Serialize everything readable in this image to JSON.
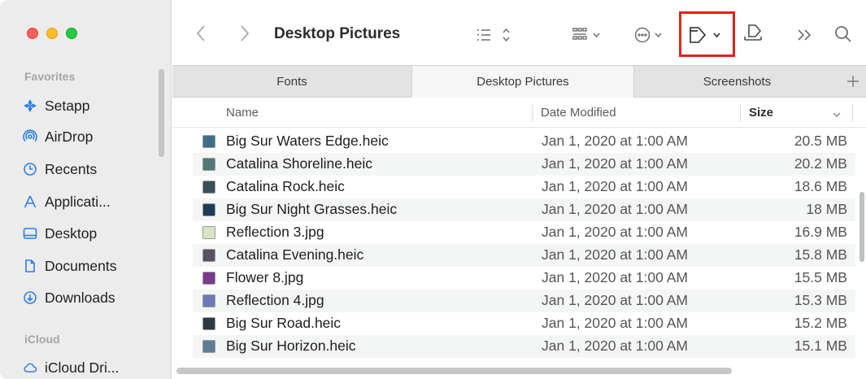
{
  "sidebar": {
    "favorites_label": "Favorites",
    "items": [
      {
        "label": "Setapp",
        "icon": "setapp-icon"
      },
      {
        "label": "AirDrop",
        "icon": "airdrop-icon"
      },
      {
        "label": "Recents",
        "icon": "clock-icon"
      },
      {
        "label": "Applicati...",
        "icon": "applications-icon"
      },
      {
        "label": "Desktop",
        "icon": "desktop-icon"
      },
      {
        "label": "Documents",
        "icon": "document-icon"
      },
      {
        "label": "Downloads",
        "icon": "download-icon"
      }
    ],
    "icloud_label": "iCloud",
    "icloud_items": [
      {
        "label": "iCloud Dri...",
        "icon": "cloud-icon"
      }
    ]
  },
  "toolbar": {
    "title": "Desktop Pictures"
  },
  "tabs": [
    {
      "label": "Fonts"
    },
    {
      "label": "Desktop Pictures",
      "active": true
    },
    {
      "label": "Screenshots"
    }
  ],
  "columns": {
    "name": "Name",
    "date": "Date Modified",
    "size": "Size"
  },
  "files": [
    {
      "name": "Big Sur Waters Edge.heic",
      "date": "Jan 1, 2020 at 1:00 AM",
      "size": "20.5 MB",
      "thumb": "#3e6e8c"
    },
    {
      "name": "Catalina Shoreline.heic",
      "date": "Jan 1, 2020 at 1:00 AM",
      "size": "20.2 MB",
      "thumb": "#4f7a77"
    },
    {
      "name": "Catalina Rock.heic",
      "date": "Jan 1, 2020 at 1:00 AM",
      "size": "18.6 MB",
      "thumb": "#37505a"
    },
    {
      "name": "Big Sur Night Grasses.heic",
      "date": "Jan 1, 2020 at 1:00 AM",
      "size": "18 MB",
      "thumb": "#1b3c5c"
    },
    {
      "name": "Reflection 3.jpg",
      "date": "Jan 1, 2020 at 1:00 AM",
      "size": "16.9 MB",
      "thumb": "#d9e6c4"
    },
    {
      "name": "Catalina Evening.heic",
      "date": "Jan 1, 2020 at 1:00 AM",
      "size": "15.8 MB",
      "thumb": "#5a5066"
    },
    {
      "name": "Flower 8.jpg",
      "date": "Jan 1, 2020 at 1:00 AM",
      "size": "15.5 MB",
      "thumb": "#7a3a8c"
    },
    {
      "name": "Reflection 4.jpg",
      "date": "Jan 1, 2020 at 1:00 AM",
      "size": "15.3 MB",
      "thumb": "#6c79b8"
    },
    {
      "name": "Big Sur Road.heic",
      "date": "Jan 1, 2020 at 1:00 AM",
      "size": "15.2 MB",
      "thumb": "#2f3a45"
    },
    {
      "name": "Big Sur Horizon.heic",
      "date": "Jan 1, 2020 at 1:00 AM",
      "size": "15.1 MB",
      "thumb": "#5d7f96"
    }
  ],
  "colors": {
    "accent": "#2a7fe8",
    "highlight_box": "#e2231a"
  }
}
